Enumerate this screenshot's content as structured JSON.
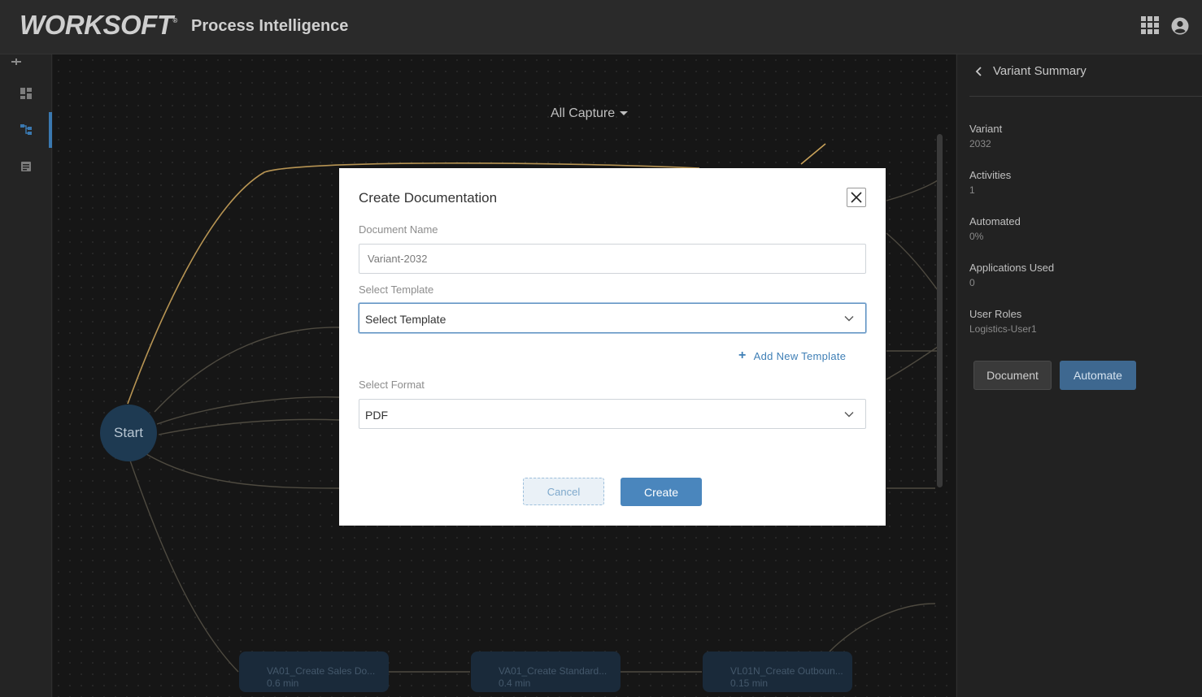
{
  "header": {
    "logo_text": "WORKSOFT",
    "logo_mark": "®",
    "product_name": "Process Intelligence",
    "apps_icon": "grid-apps-icon",
    "user_icon": "user-account-icon"
  },
  "leftnav": {
    "items": [
      {
        "icon": "pin-icon"
      },
      {
        "icon": "dashboard-icon"
      },
      {
        "icon": "process-map-icon",
        "active": true
      },
      {
        "icon": "document-icon"
      }
    ]
  },
  "canvas": {
    "filter_label": "All Capture",
    "start_node": "Start",
    "nodes": [
      {
        "label": "VA01_Create Sales Do...",
        "time": "0.6 min"
      },
      {
        "label": "VA01_Create Standard...",
        "time": "0.4 min"
      },
      {
        "label": "VL01N_Create Outboun...",
        "time": "0.15 min"
      }
    ]
  },
  "right_panel": {
    "title": "Variant Summary",
    "fields": [
      {
        "label": "Variant",
        "value": "2032"
      },
      {
        "label": "Activities",
        "value": "1"
      },
      {
        "label": "Automated",
        "value": "0%"
      },
      {
        "label": "Applications Used",
        "value": "0"
      },
      {
        "label": "User Roles",
        "value": "Logistics-User1"
      }
    ],
    "document_button": "Document",
    "automate_button": "Automate"
  },
  "modal": {
    "title": "Create Documentation",
    "doc_name_label": "Document Name",
    "doc_name_value": "Variant-2032",
    "template_label": "Select Template",
    "template_value": "Select Template",
    "add_template": "Add New Template",
    "format_label": "Select Format",
    "format_value": "PDF",
    "cancel": "Cancel",
    "create": "Create"
  },
  "colors": {
    "accent": "#4a86bd",
    "edge_highlight": "#c9a25a",
    "panel_bg": "#222222",
    "canvas_bg": "#161616"
  }
}
